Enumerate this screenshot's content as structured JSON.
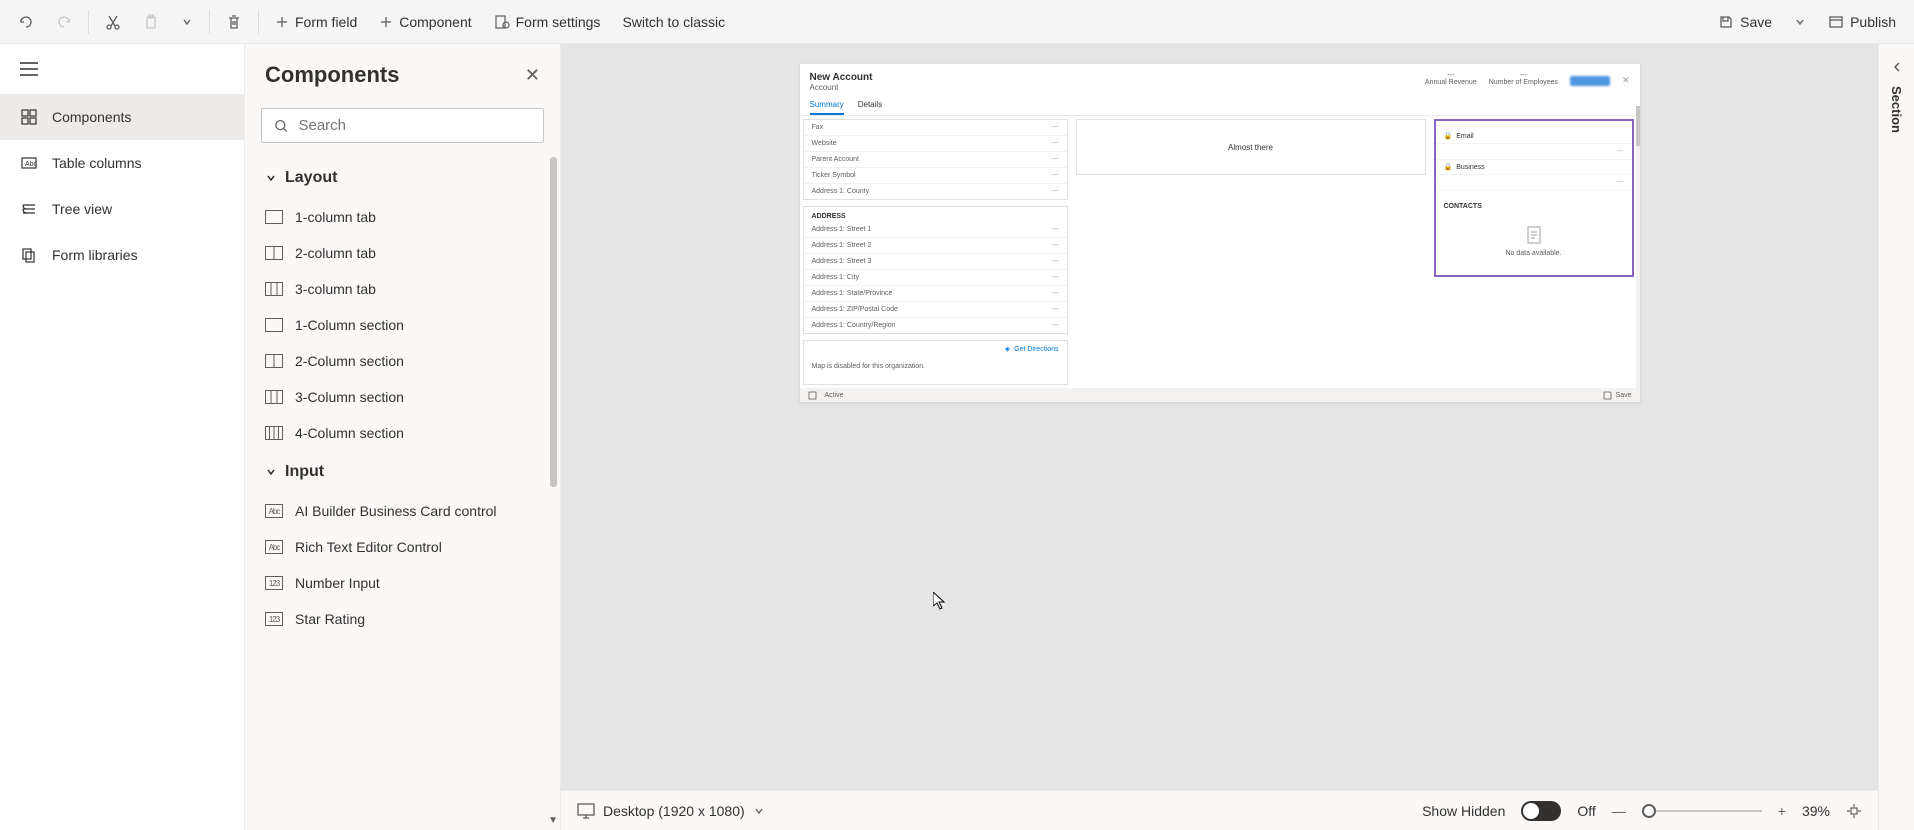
{
  "toolbar": {
    "form_field": "Form field",
    "component": "Component",
    "form_settings": "Form settings",
    "switch_classic": "Switch to classic",
    "save": "Save",
    "publish": "Publish"
  },
  "nav": {
    "components": "Components",
    "table_columns": "Table columns",
    "tree_view": "Tree view",
    "form_libraries": "Form libraries"
  },
  "panel": {
    "title": "Components",
    "search_placeholder": "Search",
    "layout_header": "Layout",
    "layout_items": [
      "1-column tab",
      "2-column tab",
      "3-column tab",
      "1-Column section",
      "2-Column section",
      "3-Column section",
      "4-Column section"
    ],
    "input_header": "Input",
    "input_items": [
      "AI Builder Business Card control",
      "Rich Text Editor Control",
      "Number Input",
      "Star Rating"
    ]
  },
  "form": {
    "title": "New Account",
    "subtitle": "Account",
    "header_cols": [
      {
        "val": "---",
        "lbl": "Annual Revenue"
      },
      {
        "val": "---",
        "lbl": "Number of Employees"
      }
    ],
    "tabs": [
      "Summary",
      "Details"
    ],
    "active_tab": 0,
    "col1_top": [
      {
        "label": "Fax",
        "val": "---"
      },
      {
        "label": "Website",
        "val": "---"
      },
      {
        "label": "Parent Account",
        "val": "---"
      },
      {
        "label": "Ticker Symbol",
        "val": "---"
      },
      {
        "label": "Address 1: County",
        "val": "---"
      }
    ],
    "address_title": "ADDRESS",
    "col1_addr": [
      {
        "label": "Address 1: Street 1",
        "val": "---"
      },
      {
        "label": "Address 1: Street 2",
        "val": "---"
      },
      {
        "label": "Address 1: Street 3",
        "val": "---"
      },
      {
        "label": "Address 1: City",
        "val": "---"
      },
      {
        "label": "Address 1: State/Province",
        "val": "---"
      },
      {
        "label": "Address 1: ZIP/Postal Code",
        "val": "---"
      },
      {
        "label": "Address 1: Country/Region",
        "val": "---"
      }
    ],
    "map_get_dir": "Get Directions",
    "map_disabled": "Map is disabled for this organization.",
    "timeline": "Almost there",
    "locks": [
      {
        "label": "Email",
        "val": "---"
      },
      {
        "label": "Business",
        "val": "---"
      }
    ],
    "contacts_title": "CONTACTS",
    "no_data": "No data available.",
    "footer_status": "Active",
    "footer_save": "Save"
  },
  "bottom": {
    "device": "Desktop (1920 x 1080)",
    "show_hidden": "Show Hidden",
    "toggle_label": "Off",
    "zoom": "39%"
  },
  "right_panel": {
    "label": "Section"
  }
}
